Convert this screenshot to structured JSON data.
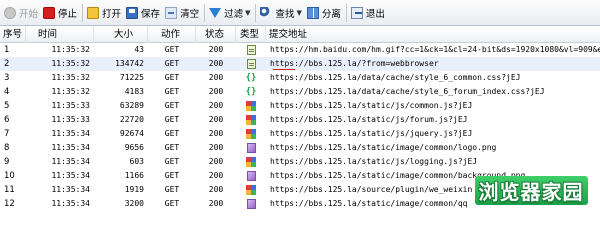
{
  "toolbar": {
    "start": {
      "label": "开始",
      "icon": "start-icon"
    },
    "stop": {
      "label": "停止",
      "icon": "stop-icon"
    },
    "open": {
      "label": "打开",
      "icon": "open-folder-icon"
    },
    "save": {
      "label": "保存",
      "icon": "save-icon"
    },
    "clear": {
      "label": "清空",
      "icon": "clear-icon"
    },
    "filter": {
      "label": "过滤",
      "icon": "filter-icon"
    },
    "find": {
      "label": "查找",
      "icon": "binoculars-icon"
    },
    "split": {
      "label": "分离",
      "icon": "split-window-icon"
    },
    "exit": {
      "label": "退出",
      "icon": "exit-icon"
    }
  },
  "columns": {
    "num": "序号",
    "time": "时间",
    "size": "大小",
    "action": "动作",
    "status": "状态",
    "type": "类型",
    "url": "提交地址"
  },
  "rows": [
    {
      "num": "1",
      "time": "11:35:32",
      "size": "43",
      "action": "GET",
      "status": "200",
      "type": "doc",
      "url": "https://hm.baidu.com/hm.gif?cc=1&ck=1&cl=24-bit&ds=1920x1080&vl=909&ep=2"
    },
    {
      "num": "2",
      "time": "11:35:32",
      "size": "134742",
      "action": "GET",
      "status": "200",
      "type": "doc",
      "url": "https://bbs.125.la/?from=webbrowser"
    },
    {
      "num": "3",
      "time": "11:35:32",
      "size": "71225",
      "action": "GET",
      "status": "200",
      "type": "css",
      "url": "https://bbs.125.la/data/cache/style_6_common.css?jEJ"
    },
    {
      "num": "4",
      "time": "11:35:32",
      "size": "4183",
      "action": "GET",
      "status": "200",
      "type": "css",
      "url": "https://bbs.125.la/data/cache/style_6_forum_index.css?jEJ"
    },
    {
      "num": "5",
      "time": "11:35:33",
      "size": "63289",
      "action": "GET",
      "status": "200",
      "type": "js",
      "url": "https://bbs.125.la/static/js/common.js?jEJ"
    },
    {
      "num": "6",
      "time": "11:35:33",
      "size": "22720",
      "action": "GET",
      "status": "200",
      "type": "js",
      "url": "https://bbs.125.la/static/js/forum.js?jEJ"
    },
    {
      "num": "7",
      "time": "11:35:34",
      "size": "92674",
      "action": "GET",
      "status": "200",
      "type": "js",
      "url": "https://bbs.125.la/static/js/jquery.js?jEJ"
    },
    {
      "num": "8",
      "time": "11:35:34",
      "size": "9656",
      "action": "GET",
      "status": "200",
      "type": "image",
      "url": "https://bbs.125.la/static/image/common/logo.png"
    },
    {
      "num": "9",
      "time": "11:35:34",
      "size": "603",
      "action": "GET",
      "status": "200",
      "type": "js",
      "url": "https://bbs.125.la/static/js/logging.js?jEJ"
    },
    {
      "num": "10",
      "time": "11:35:34",
      "size": "1166",
      "action": "GET",
      "status": "200",
      "type": "image",
      "url": "https://bbs.125.la/static/image/common/background.png"
    },
    {
      "num": "11",
      "time": "11:35:34",
      "size": "1919",
      "action": "GET",
      "status": "200",
      "type": "js",
      "url": "https://bbs.125.la/source/plugin/we_weixin"
    },
    {
      "num": "12",
      "time": "11:35:34",
      "size": "3200",
      "action": "GET",
      "status": "200",
      "type": "image",
      "url": "https://bbs.125.la/static/image/common/qq"
    }
  ],
  "watermark": "浏览器家园",
  "colors": {
    "stop": "#d91c1c",
    "css_type": "#2a9d4a",
    "image_type": "#9b62cc",
    "highlight_underline": "#e02020",
    "watermark_green": "#1aa348"
  }
}
